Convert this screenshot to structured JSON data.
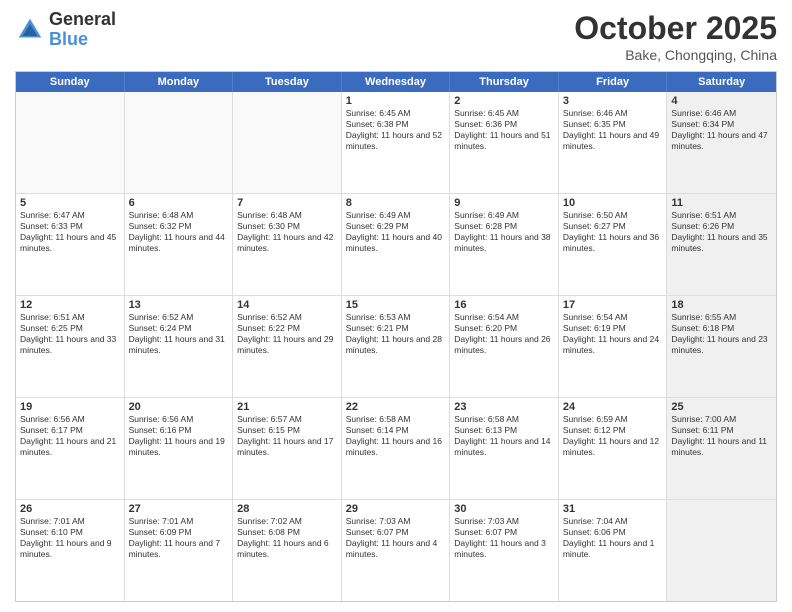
{
  "header": {
    "logo_general": "General",
    "logo_blue": "Blue",
    "month": "October 2025",
    "location": "Bake, Chongqing, China"
  },
  "weekdays": [
    "Sunday",
    "Monday",
    "Tuesday",
    "Wednesday",
    "Thursday",
    "Friday",
    "Saturday"
  ],
  "rows": [
    [
      {
        "day": "",
        "sunrise": "",
        "sunset": "",
        "daylight": "",
        "shaded": false,
        "empty": true
      },
      {
        "day": "",
        "sunrise": "",
        "sunset": "",
        "daylight": "",
        "shaded": false,
        "empty": true
      },
      {
        "day": "",
        "sunrise": "",
        "sunset": "",
        "daylight": "",
        "shaded": false,
        "empty": true
      },
      {
        "day": "1",
        "sunrise": "Sunrise: 6:45 AM",
        "sunset": "Sunset: 6:38 PM",
        "daylight": "Daylight: 11 hours and 52 minutes.",
        "shaded": false,
        "empty": false
      },
      {
        "day": "2",
        "sunrise": "Sunrise: 6:45 AM",
        "sunset": "Sunset: 6:36 PM",
        "daylight": "Daylight: 11 hours and 51 minutes.",
        "shaded": false,
        "empty": false
      },
      {
        "day": "3",
        "sunrise": "Sunrise: 6:46 AM",
        "sunset": "Sunset: 6:35 PM",
        "daylight": "Daylight: 11 hours and 49 minutes.",
        "shaded": false,
        "empty": false
      },
      {
        "day": "4",
        "sunrise": "Sunrise: 6:46 AM",
        "sunset": "Sunset: 6:34 PM",
        "daylight": "Daylight: 11 hours and 47 minutes.",
        "shaded": true,
        "empty": false
      }
    ],
    [
      {
        "day": "5",
        "sunrise": "Sunrise: 6:47 AM",
        "sunset": "Sunset: 6:33 PM",
        "daylight": "Daylight: 11 hours and 45 minutes.",
        "shaded": false,
        "empty": false
      },
      {
        "day": "6",
        "sunrise": "Sunrise: 6:48 AM",
        "sunset": "Sunset: 6:32 PM",
        "daylight": "Daylight: 11 hours and 44 minutes.",
        "shaded": false,
        "empty": false
      },
      {
        "day": "7",
        "sunrise": "Sunrise: 6:48 AM",
        "sunset": "Sunset: 6:30 PM",
        "daylight": "Daylight: 11 hours and 42 minutes.",
        "shaded": false,
        "empty": false
      },
      {
        "day": "8",
        "sunrise": "Sunrise: 6:49 AM",
        "sunset": "Sunset: 6:29 PM",
        "daylight": "Daylight: 11 hours and 40 minutes.",
        "shaded": false,
        "empty": false
      },
      {
        "day": "9",
        "sunrise": "Sunrise: 6:49 AM",
        "sunset": "Sunset: 6:28 PM",
        "daylight": "Daylight: 11 hours and 38 minutes.",
        "shaded": false,
        "empty": false
      },
      {
        "day": "10",
        "sunrise": "Sunrise: 6:50 AM",
        "sunset": "Sunset: 6:27 PM",
        "daylight": "Daylight: 11 hours and 36 minutes.",
        "shaded": false,
        "empty": false
      },
      {
        "day": "11",
        "sunrise": "Sunrise: 6:51 AM",
        "sunset": "Sunset: 6:26 PM",
        "daylight": "Daylight: 11 hours and 35 minutes.",
        "shaded": true,
        "empty": false
      }
    ],
    [
      {
        "day": "12",
        "sunrise": "Sunrise: 6:51 AM",
        "sunset": "Sunset: 6:25 PM",
        "daylight": "Daylight: 11 hours and 33 minutes.",
        "shaded": false,
        "empty": false
      },
      {
        "day": "13",
        "sunrise": "Sunrise: 6:52 AM",
        "sunset": "Sunset: 6:24 PM",
        "daylight": "Daylight: 11 hours and 31 minutes.",
        "shaded": false,
        "empty": false
      },
      {
        "day": "14",
        "sunrise": "Sunrise: 6:52 AM",
        "sunset": "Sunset: 6:22 PM",
        "daylight": "Daylight: 11 hours and 29 minutes.",
        "shaded": false,
        "empty": false
      },
      {
        "day": "15",
        "sunrise": "Sunrise: 6:53 AM",
        "sunset": "Sunset: 6:21 PM",
        "daylight": "Daylight: 11 hours and 28 minutes.",
        "shaded": false,
        "empty": false
      },
      {
        "day": "16",
        "sunrise": "Sunrise: 6:54 AM",
        "sunset": "Sunset: 6:20 PM",
        "daylight": "Daylight: 11 hours and 26 minutes.",
        "shaded": false,
        "empty": false
      },
      {
        "day": "17",
        "sunrise": "Sunrise: 6:54 AM",
        "sunset": "Sunset: 6:19 PM",
        "daylight": "Daylight: 11 hours and 24 minutes.",
        "shaded": false,
        "empty": false
      },
      {
        "day": "18",
        "sunrise": "Sunrise: 6:55 AM",
        "sunset": "Sunset: 6:18 PM",
        "daylight": "Daylight: 11 hours and 23 minutes.",
        "shaded": true,
        "empty": false
      }
    ],
    [
      {
        "day": "19",
        "sunrise": "Sunrise: 6:56 AM",
        "sunset": "Sunset: 6:17 PM",
        "daylight": "Daylight: 11 hours and 21 minutes.",
        "shaded": false,
        "empty": false
      },
      {
        "day": "20",
        "sunrise": "Sunrise: 6:56 AM",
        "sunset": "Sunset: 6:16 PM",
        "daylight": "Daylight: 11 hours and 19 minutes.",
        "shaded": false,
        "empty": false
      },
      {
        "day": "21",
        "sunrise": "Sunrise: 6:57 AM",
        "sunset": "Sunset: 6:15 PM",
        "daylight": "Daylight: 11 hours and 17 minutes.",
        "shaded": false,
        "empty": false
      },
      {
        "day": "22",
        "sunrise": "Sunrise: 6:58 AM",
        "sunset": "Sunset: 6:14 PM",
        "daylight": "Daylight: 11 hours and 16 minutes.",
        "shaded": false,
        "empty": false
      },
      {
        "day": "23",
        "sunrise": "Sunrise: 6:58 AM",
        "sunset": "Sunset: 6:13 PM",
        "daylight": "Daylight: 11 hours and 14 minutes.",
        "shaded": false,
        "empty": false
      },
      {
        "day": "24",
        "sunrise": "Sunrise: 6:59 AM",
        "sunset": "Sunset: 6:12 PM",
        "daylight": "Daylight: 11 hours and 12 minutes.",
        "shaded": false,
        "empty": false
      },
      {
        "day": "25",
        "sunrise": "Sunrise: 7:00 AM",
        "sunset": "Sunset: 6:11 PM",
        "daylight": "Daylight: 11 hours and 11 minutes.",
        "shaded": true,
        "empty": false
      }
    ],
    [
      {
        "day": "26",
        "sunrise": "Sunrise: 7:01 AM",
        "sunset": "Sunset: 6:10 PM",
        "daylight": "Daylight: 11 hours and 9 minutes.",
        "shaded": false,
        "empty": false
      },
      {
        "day": "27",
        "sunrise": "Sunrise: 7:01 AM",
        "sunset": "Sunset: 6:09 PM",
        "daylight": "Daylight: 11 hours and 7 minutes.",
        "shaded": false,
        "empty": false
      },
      {
        "day": "28",
        "sunrise": "Sunrise: 7:02 AM",
        "sunset": "Sunset: 6:08 PM",
        "daylight": "Daylight: 11 hours and 6 minutes.",
        "shaded": false,
        "empty": false
      },
      {
        "day": "29",
        "sunrise": "Sunrise: 7:03 AM",
        "sunset": "Sunset: 6:07 PM",
        "daylight": "Daylight: 11 hours and 4 minutes.",
        "shaded": false,
        "empty": false
      },
      {
        "day": "30",
        "sunrise": "Sunrise: 7:03 AM",
        "sunset": "Sunset: 6:07 PM",
        "daylight": "Daylight: 11 hours and 3 minutes.",
        "shaded": false,
        "empty": false
      },
      {
        "day": "31",
        "sunrise": "Sunrise: 7:04 AM",
        "sunset": "Sunset: 6:06 PM",
        "daylight": "Daylight: 11 hours and 1 minute.",
        "shaded": false,
        "empty": false
      },
      {
        "day": "",
        "sunrise": "",
        "sunset": "",
        "daylight": "",
        "shaded": true,
        "empty": true
      }
    ]
  ]
}
